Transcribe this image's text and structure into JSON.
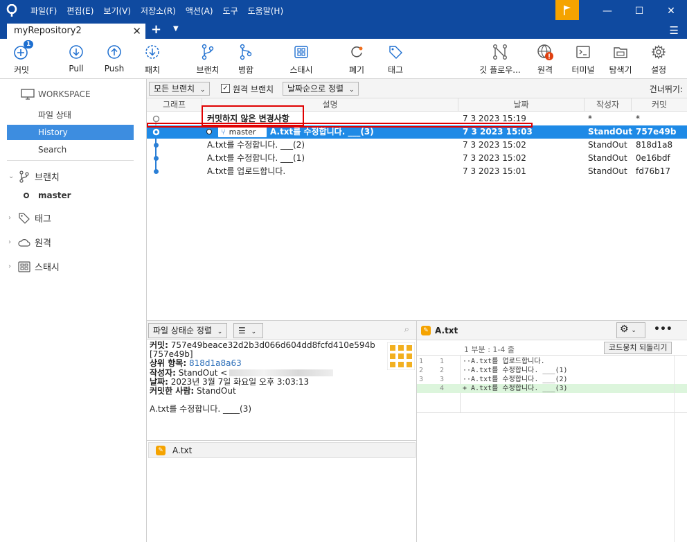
{
  "window": {
    "menu": [
      "파일(F)",
      "편집(E)",
      "보기(V)",
      "저장소(R)",
      "액션(A)",
      "도구",
      "도움말(H)"
    ],
    "tab_title": "myRepository2"
  },
  "toolbar": {
    "commit": "커밋",
    "commit_badge": "1",
    "pull": "Pull",
    "push": "Push",
    "fetch": "패치",
    "branch": "브랜치",
    "merge": "병합",
    "stash": "스태시",
    "discard": "폐기",
    "tag": "태그",
    "git_flow": "깃 플로우...",
    "remote": "원격",
    "terminal": "터미널",
    "explorer": "탐색기",
    "settings": "설정"
  },
  "sidebar": {
    "workspace": "WORKSPACE",
    "items": [
      "파일 상태",
      "History",
      "Search"
    ],
    "branches": "브랜치",
    "current_branch": "master",
    "tags": "태그",
    "remotes": "원격",
    "stashes": "스태시"
  },
  "filters": {
    "branches_dropdown": "모든 브랜치",
    "remote_branches": "원격 브랜치",
    "sort_dropdown": "날짜순으로 정렬",
    "jump_to": "건너뛰기:"
  },
  "table": {
    "headers": {
      "graph": "그래프",
      "description": "설명",
      "date": "날짜",
      "author": "작성자",
      "commit": "커밋"
    },
    "rows": [
      {
        "desc": "커밋하지 않은 변경사항",
        "date": "7 3 2023 15:19",
        "author": "*",
        "commit": "*"
      },
      {
        "desc": "A.txt를 수정합니다. ___(3)",
        "branch": "master",
        "date": "7 3 2023 15:03",
        "author": "StandOut",
        "commit": "757e49b"
      },
      {
        "desc": "A.txt를 수정합니다. ___(2)",
        "date": "7 3 2023 15:02",
        "author": "StandOut",
        "commit": "818d1a8"
      },
      {
        "desc": "A.txt를 수정합니다. ___(1)",
        "date": "7 3 2023 15:02",
        "author": "StandOut",
        "commit": "0e16bdf"
      },
      {
        "desc": "A.txt를 업로드합니다.",
        "date": "7 3 2023 15:01",
        "author": "StandOut",
        "commit": "fd76b17"
      }
    ]
  },
  "details": {
    "sort_dropdown": "파일 상태순 정렬",
    "commit_label": "커밋:",
    "commit_hash": "757e49beace32d2b3d066d604dd8fcfd410e594b",
    "commit_short": "[757e49b]",
    "parent_label": "상위 항목:",
    "parent_hash": "818d1a8a63",
    "author_label": "작성자:",
    "author_value": "StandOut <",
    "date_label": "날짜:",
    "date_value": "2023년 3월 7일 화요일 오후 3:03:13",
    "committer_label": "커밋한 사람:",
    "committer_value": "StandOut",
    "message": "A.txt를 수정합니다. ____(3)",
    "file_name": "A.txt"
  },
  "diff": {
    "file_name": "A.txt",
    "hunk_header": "1 부분 : 1-4 줄",
    "revert_button": "코드뭉치 되돌리기",
    "lines": [
      {
        "old": "1",
        "new": "1",
        "text": "··A.txt를 업로드합니다."
      },
      {
        "old": "2",
        "new": "2",
        "text": "··A.txt를 수정합니다. ___(1)"
      },
      {
        "old": "3",
        "new": "3",
        "text": "··A.txt를 수정합니다. ___(2)"
      },
      {
        "old": "",
        "new": "4",
        "text": "+ A.txt를 수정합니다. ___(3)"
      }
    ]
  },
  "colors": {
    "titlebar": "#0f4aa0",
    "selection": "#1e8ae6",
    "accent": "#f5a300",
    "highlight_box": "#e00000"
  }
}
